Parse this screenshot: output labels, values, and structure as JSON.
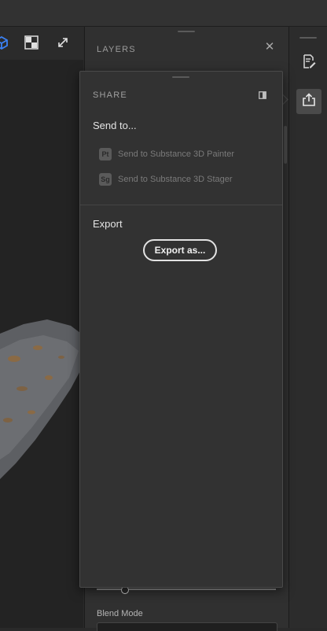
{
  "layers_panel": {
    "title": "LAYERS",
    "close_icon": "close-icon",
    "blend_mode_label": "Blend Mode"
  },
  "share_popover": {
    "title": "SHARE",
    "send_to_label": "Send to...",
    "send_targets": [
      {
        "badge": "Pt",
        "label": "Send to Substance 3D Painter"
      },
      {
        "badge": "Sg",
        "label": "Send to Substance 3D Stager"
      }
    ],
    "export_section_label": "Export",
    "export_button_label": "Export as..."
  },
  "right_rail": {
    "items": [
      {
        "icon": "properties-edit-icon",
        "active": false
      },
      {
        "icon": "share-icon",
        "active": true
      }
    ]
  },
  "viewport_toolbar": {
    "icons": [
      "3d-cube-icon",
      "checkerboard-icon",
      "expand-icon"
    ]
  },
  "colors": {
    "accent_blue": "#3b82f6",
    "panel_bg": "#323232",
    "app_bg": "#2a2a2a"
  }
}
